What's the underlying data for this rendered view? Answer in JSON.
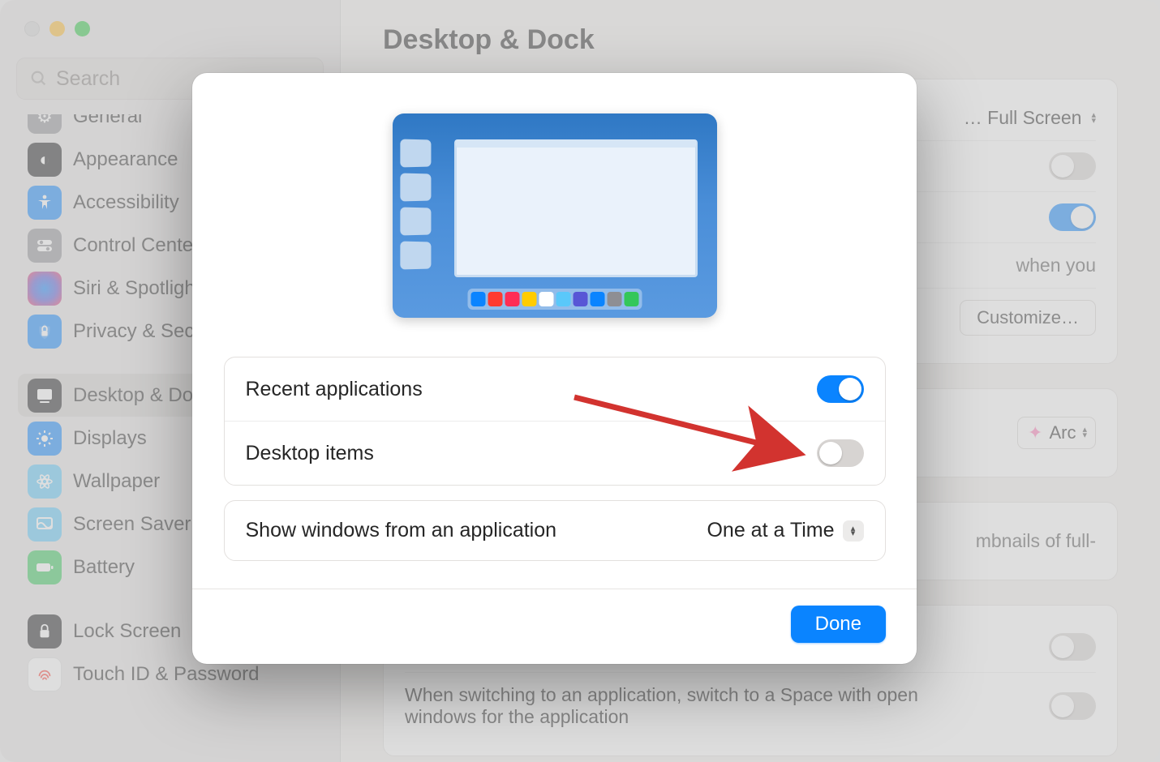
{
  "window": {
    "title": "Desktop & Dock",
    "search_placeholder": "Search"
  },
  "sidebar": {
    "items": [
      {
        "label": "General"
      },
      {
        "label": "Appearance"
      },
      {
        "label": "Accessibility"
      },
      {
        "label": "Control Center"
      },
      {
        "label": "Siri & Spotlight"
      },
      {
        "label": "Privacy & Security"
      },
      {
        "label": "Desktop & Dock",
        "selected": true
      },
      {
        "label": "Displays"
      },
      {
        "label": "Wallpaper"
      },
      {
        "label": "Screen Saver"
      },
      {
        "label": "Battery"
      },
      {
        "label": "Lock Screen"
      },
      {
        "label": "Touch ID & Password"
      }
    ]
  },
  "background": {
    "partial_text_right": "… Full Screen",
    "stage_manager_when_you": "when you",
    "customize_button": "Customize…",
    "default_browser_label": "Arc",
    "thumbnails_text": "mbnails of full-",
    "switch_app_text": "When switching to an application, switch to a Space with open windows for the application"
  },
  "sheet": {
    "rows": {
      "recent_apps": {
        "label": "Recent applications",
        "on": true
      },
      "desktop_items": {
        "label": "Desktop items",
        "on": false
      },
      "show_windows": {
        "label": "Show windows from an application",
        "value": "One at a Time"
      }
    },
    "done_button": "Done"
  },
  "dock_colors": [
    "#0a84ff",
    "#ff3b30",
    "#ff2d55",
    "#ffcc00",
    "#ffffff",
    "#5ac8fa",
    "#5856d6",
    "#0a84ff",
    "#8e8e93",
    "#34c759"
  ]
}
